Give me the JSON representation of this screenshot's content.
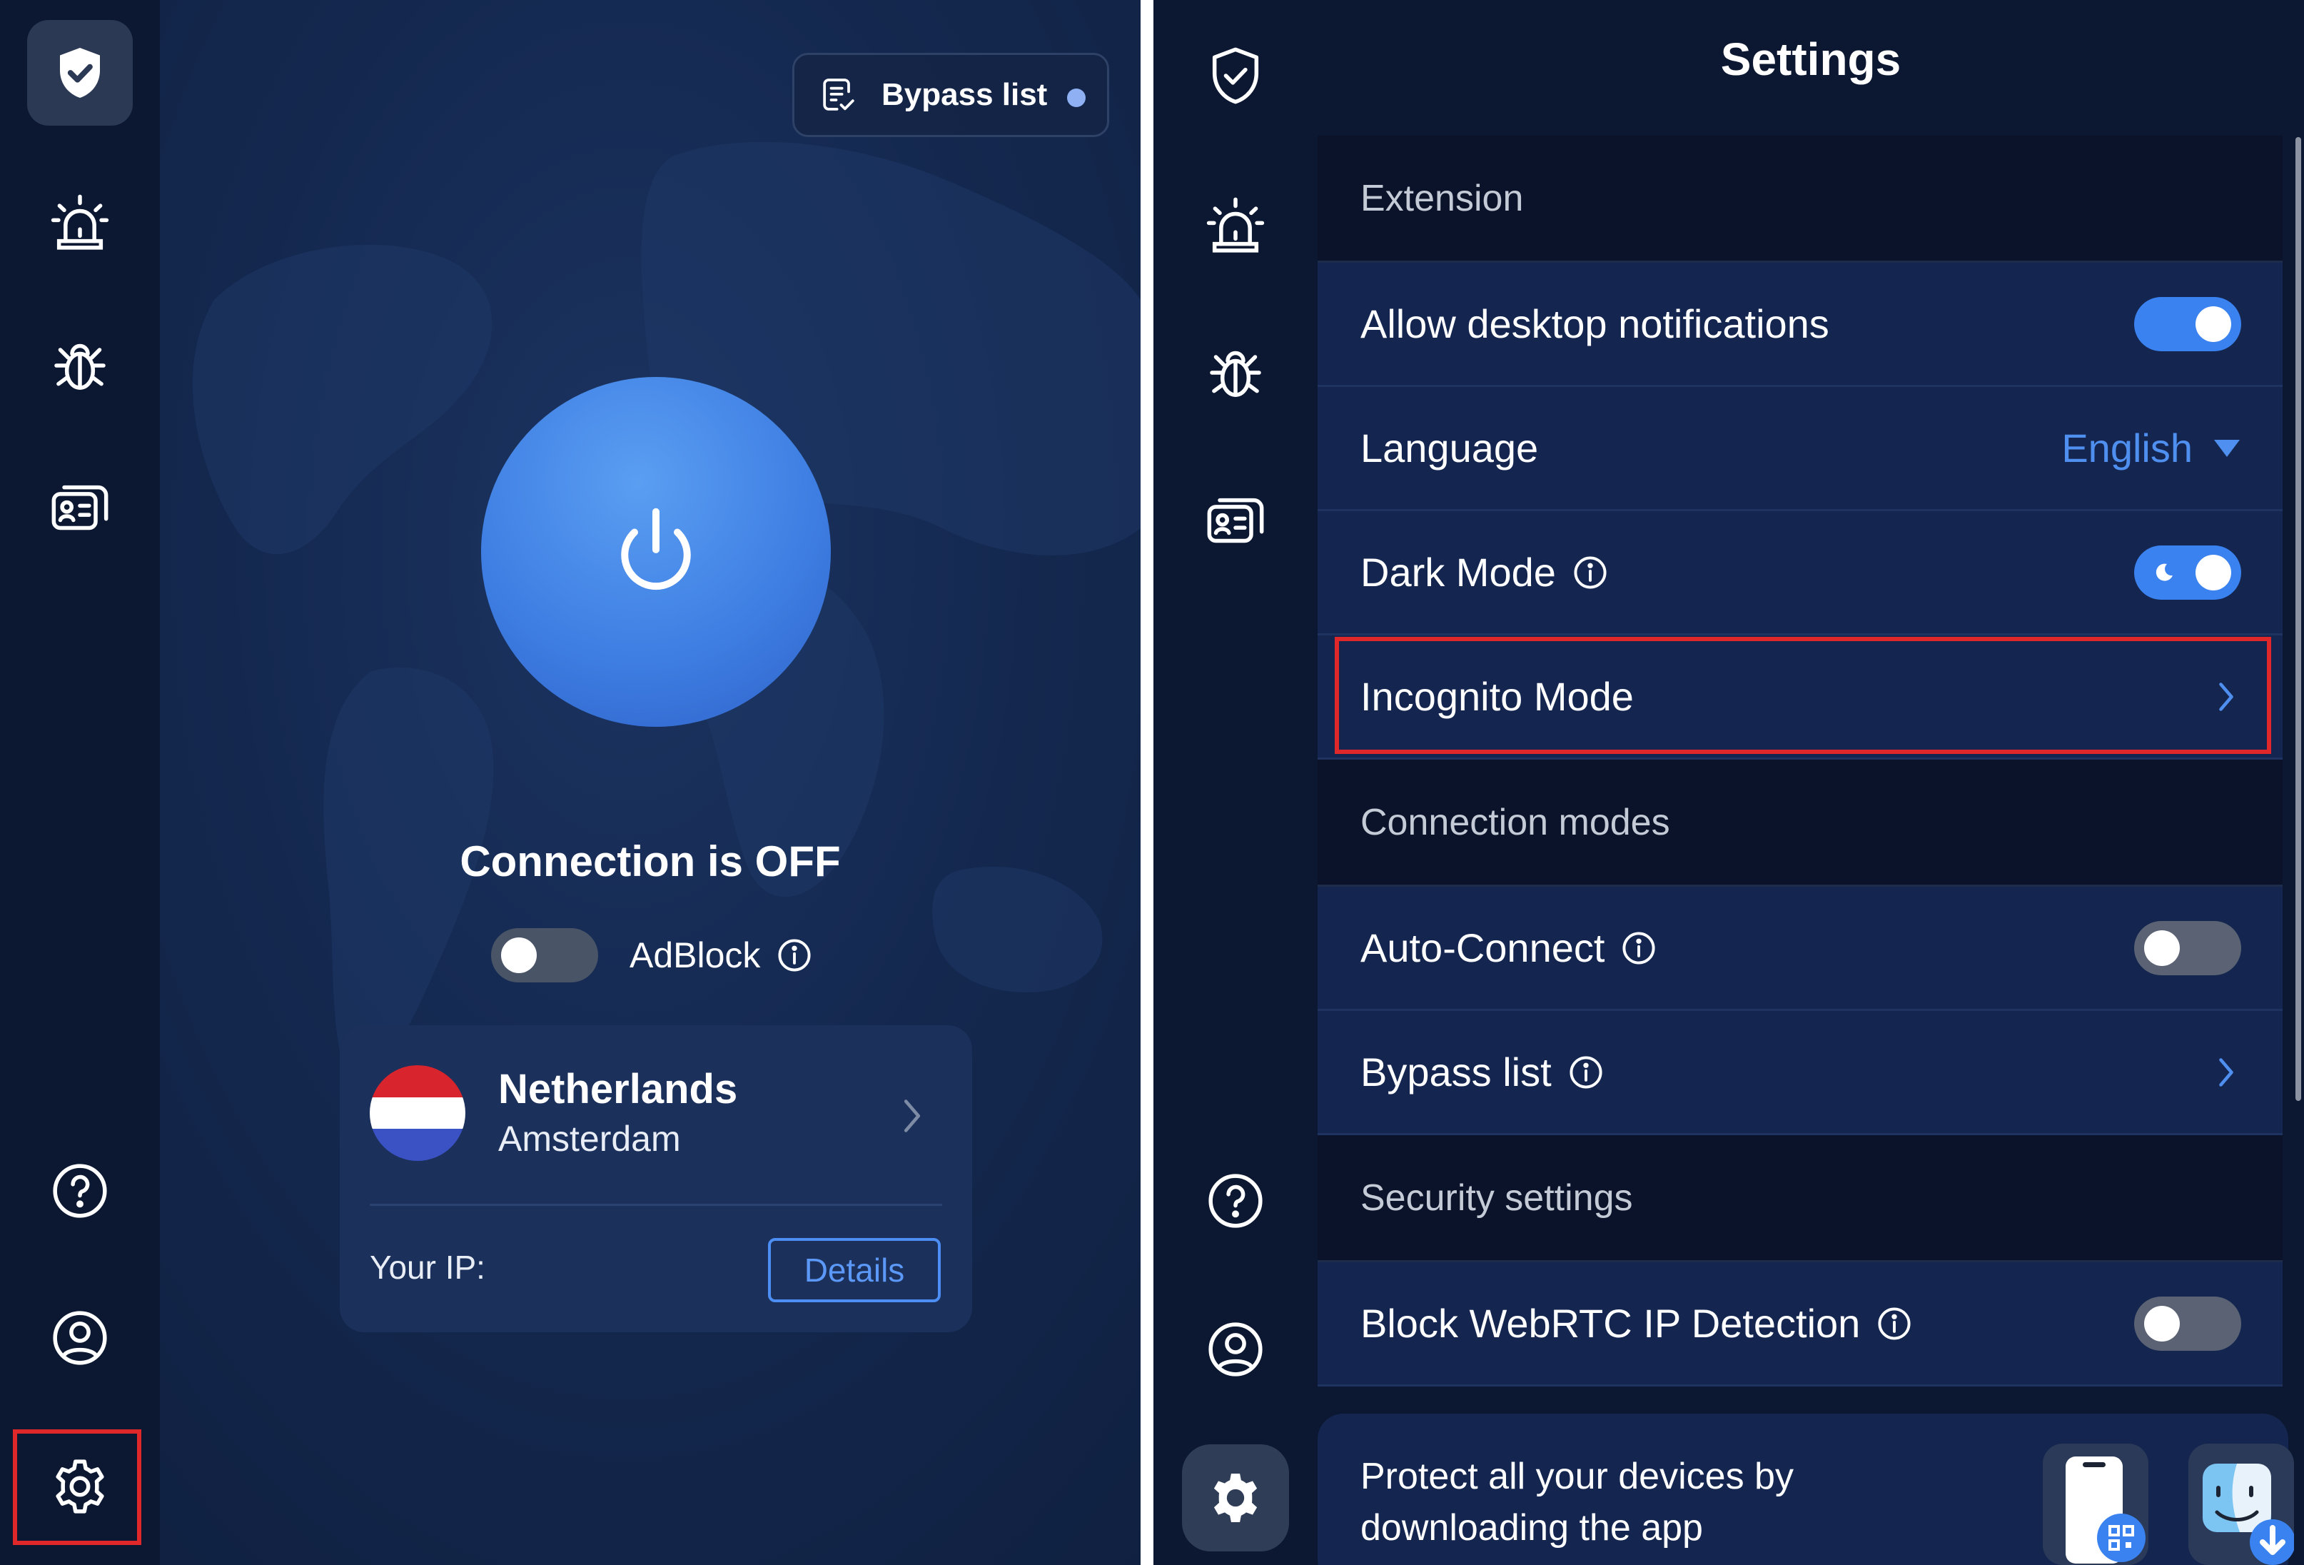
{
  "left": {
    "bypass_label": "Bypass list",
    "connection_status": "Connection is OFF",
    "adblock": {
      "label": "AdBlock",
      "enabled": false
    },
    "location": {
      "country": "Netherlands",
      "city": "Amsterdam",
      "flag_colors": [
        "#d8242c",
        "#ffffff",
        "#3a52c4"
      ]
    },
    "your_ip_label": "Your IP:",
    "details_label": "Details"
  },
  "right": {
    "title": "Settings",
    "sections": {
      "extension": "Extension",
      "connection_modes": "Connection modes",
      "security": "Security settings"
    },
    "rows": {
      "notifications": {
        "label": "Allow desktop notifications",
        "enabled": true
      },
      "language": {
        "label": "Language",
        "value": "English"
      },
      "dark_mode": {
        "label": "Dark Mode",
        "enabled": true
      },
      "incognito": {
        "label": "Incognito Mode"
      },
      "auto_connect": {
        "label": "Auto-Connect",
        "enabled": false
      },
      "bypass": {
        "label": "Bypass list"
      },
      "webrtc": {
        "label": "Block WebRTC IP Detection",
        "enabled": false
      }
    },
    "promo_text": "Protect all your devices by downloading the app"
  },
  "colors": {
    "accent": "#3a82f0",
    "highlight_box": "#e0282b",
    "background": "#0c1732"
  },
  "icons": [
    "shield-check-icon",
    "alarm-icon",
    "bug-icon",
    "id-card-icon",
    "help-icon",
    "account-icon",
    "gear-icon",
    "list-check-icon",
    "power-icon",
    "info-icon",
    "chevron-right-icon",
    "caret-down-icon",
    "moon-icon",
    "phone-qr-icon",
    "finder-download-icon"
  ]
}
